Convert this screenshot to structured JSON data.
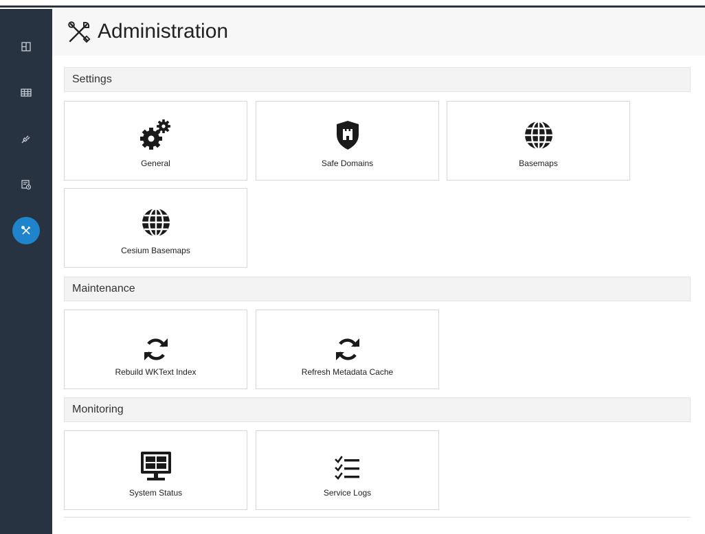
{
  "header": {
    "title": "Administration",
    "icon": "tools-icon"
  },
  "sidebar": {
    "items": [
      {
        "name": "dashboard",
        "icon": "layout-icon"
      },
      {
        "name": "tables",
        "icon": "table-icon"
      },
      {
        "name": "connectors",
        "icon": "plug-icon"
      },
      {
        "name": "reports",
        "icon": "report-icon"
      },
      {
        "name": "administration",
        "icon": "tools-icon",
        "active": true
      }
    ]
  },
  "sections": {
    "settings": {
      "label": "Settings",
      "tiles": [
        {
          "label": "General",
          "icon": "gears-icon"
        },
        {
          "label": "Safe Domains",
          "icon": "shield-icon"
        },
        {
          "label": "Basemaps",
          "icon": "globe-icon"
        },
        {
          "label": "Cesium Basemaps",
          "icon": "globe-icon"
        }
      ]
    },
    "maintenance": {
      "label": "Maintenance",
      "tiles": [
        {
          "label": "Rebuild WKText Index",
          "icon": "refresh-icon"
        },
        {
          "label": "Refresh Metadata Cache",
          "icon": "refresh-icon"
        }
      ]
    },
    "monitoring": {
      "label": "Monitoring",
      "tiles": [
        {
          "label": "System Status",
          "icon": "monitor-icon"
        },
        {
          "label": "Service Logs",
          "icon": "checklist-icon"
        }
      ]
    }
  },
  "colors": {
    "sidebar": "#283341",
    "active": "#1f84cc",
    "header_bg": "#f7f7f7",
    "section_bg": "#f3f3f3",
    "icon": "#1a1a1a"
  }
}
